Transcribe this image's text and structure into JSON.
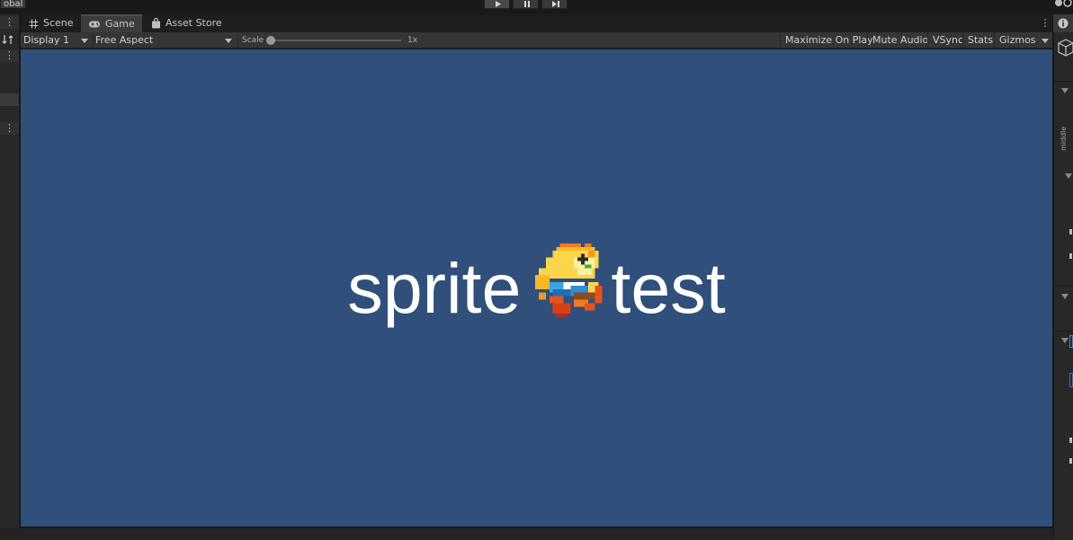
{
  "toolbar": {
    "global_label": "obal",
    "play_icon": "play-icon",
    "pause_icon": "pause-icon",
    "step_icon": "step-icon"
  },
  "tabs": [
    {
      "label": "Scene",
      "icon": "scene-grid-icon"
    },
    {
      "label": "Game",
      "icon": "gamepad-icon",
      "active": true
    },
    {
      "label": "Asset Store",
      "icon": "shopping-bag-icon"
    }
  ],
  "game_toolbar": {
    "display": "Display 1",
    "aspect": "Free Aspect",
    "scale_label": "Scale",
    "scale_value": "1x",
    "buttons": [
      "Maximize On Play",
      "Mute Audio",
      "VSync",
      "Stats",
      "Gizmos"
    ]
  },
  "game_view": {
    "text_left": "sprite",
    "text_right": "test",
    "background": "#304f7a",
    "sprite_icon": "pixel-character-sprite"
  },
  "right_panel": {
    "vertical_label": "middle"
  },
  "colors": {
    "editor_bg": "#191919",
    "panel_bg": "#282828",
    "toolbar_bg": "#353535",
    "active_tab": "#3c3c3c",
    "text": "#c4c4c4"
  }
}
